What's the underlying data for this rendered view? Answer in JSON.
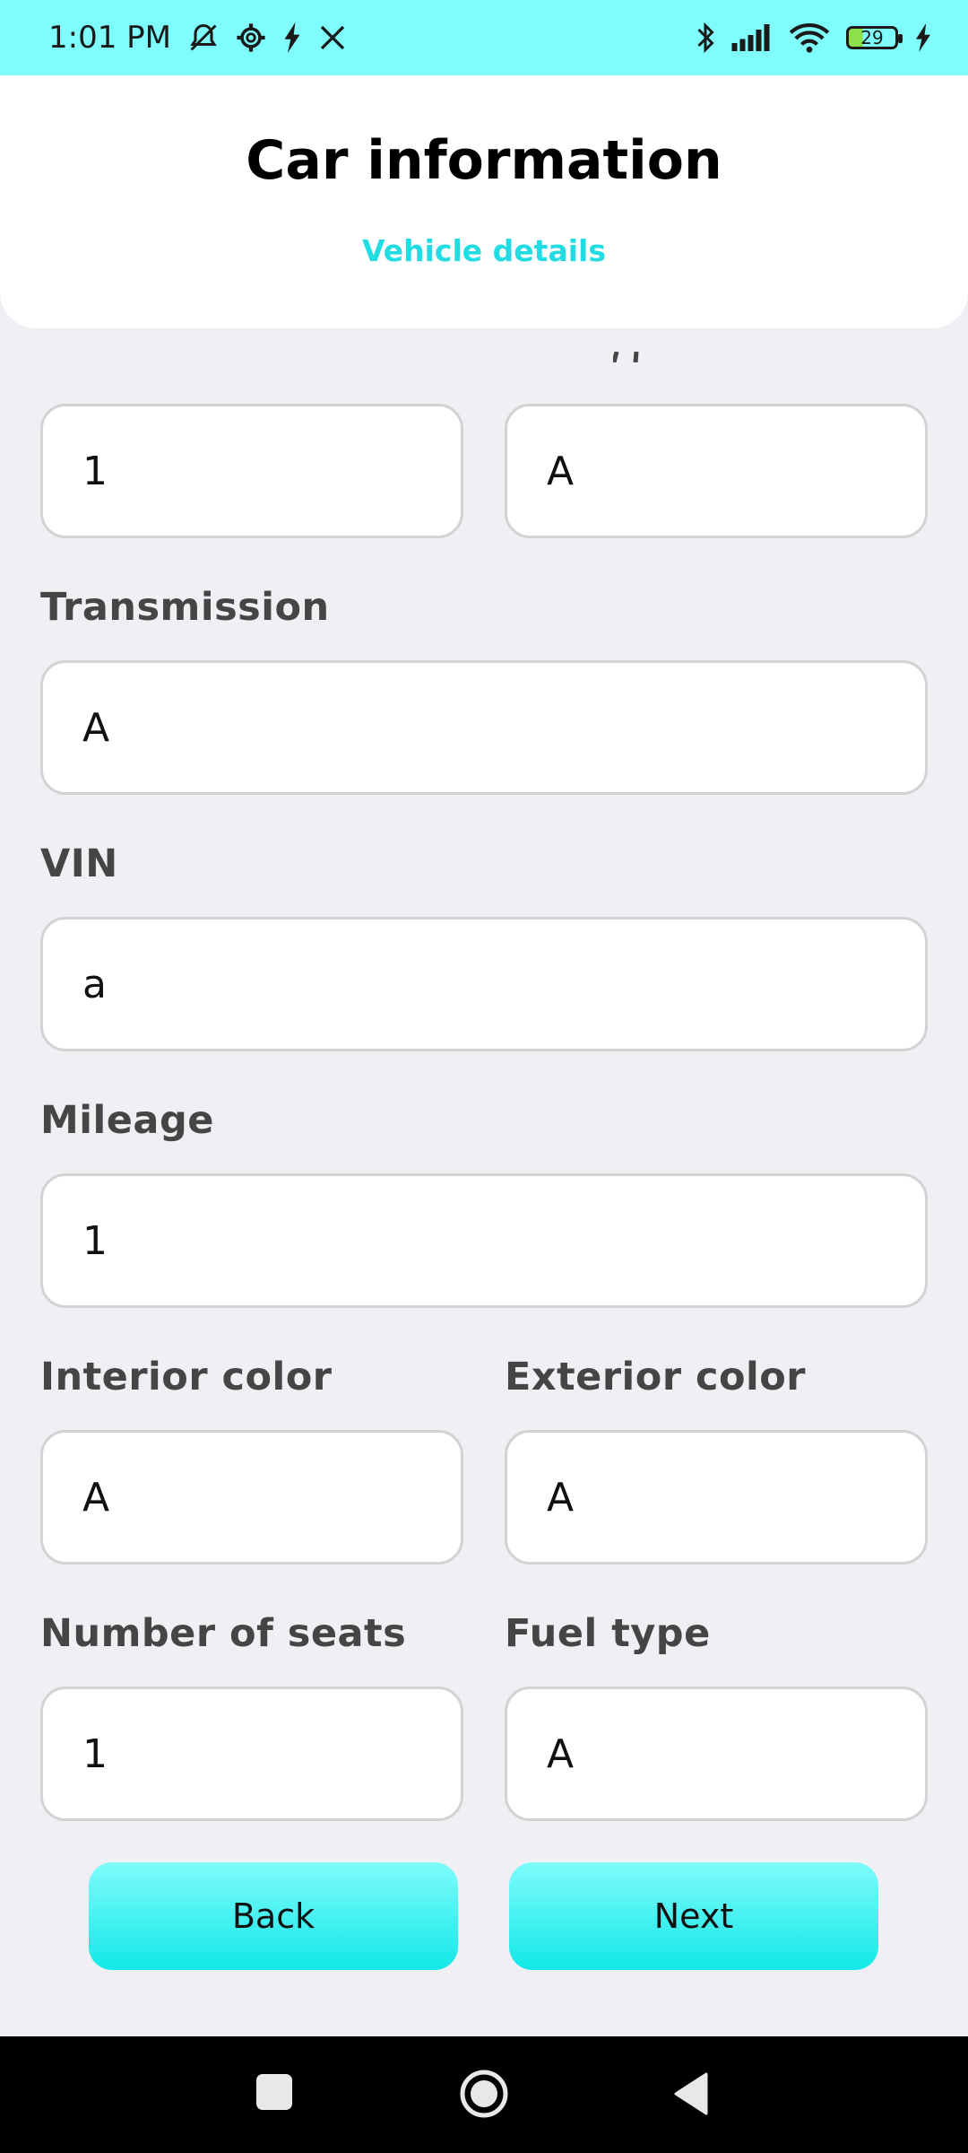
{
  "status_bar": {
    "time": "1:01 PM",
    "battery": "29",
    "icons": [
      "mute-icon",
      "settings-gear-icon",
      "charging-bolt-icon",
      "x-logo-icon",
      "bluetooth-icon",
      "signal-icon",
      "wifi-icon",
      "battery-icon",
      "charging-bolt-icon"
    ]
  },
  "header": {
    "title": "Car information",
    "subtitle": "Vehicle details"
  },
  "form": {
    "top_left_value": "1",
    "top_right_value": "A",
    "transmission": {
      "label": "Transmission",
      "value": "A"
    },
    "vin": {
      "label": "VIN",
      "value": "a"
    },
    "mileage": {
      "label": "Mileage",
      "value": "1"
    },
    "interior_color": {
      "label": "Interior color",
      "value": "A"
    },
    "exterior_color": {
      "label": "Exterior color",
      "value": "A"
    },
    "seats": {
      "label": "Number of seats",
      "value": "1"
    },
    "fuel_type": {
      "label": "Fuel type",
      "value": "A"
    }
  },
  "buttons": {
    "back": "Back",
    "next": "Next"
  },
  "colors": {
    "status_bar": "#7ffcfc",
    "accent": "#21dde3",
    "button": "#12e8e8",
    "background": "#efeff4"
  }
}
